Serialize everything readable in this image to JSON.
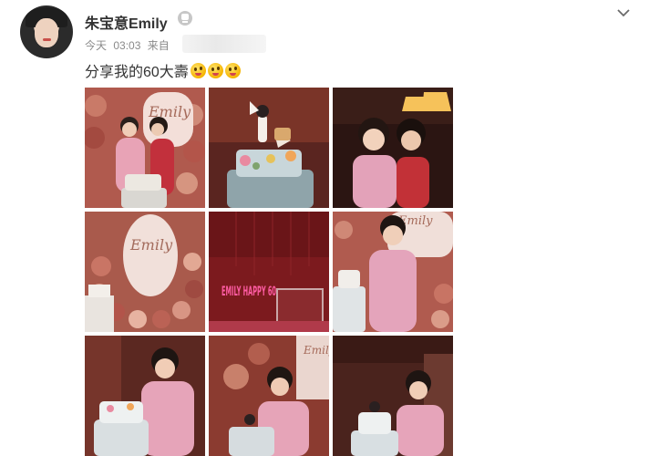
{
  "post": {
    "username": "朱宝意Emily",
    "meta": {
      "day": "今天",
      "time": "03:03",
      "from": "来自"
    },
    "text": "分享我的60大壽",
    "emoji_icon": "laughing-tongue-emoji"
  },
  "icons": {
    "badge": "robot-badge-icon",
    "menu": "chevron-down-icon"
  },
  "photos": [
    {
      "name": "photo-1",
      "desc_visible_text": "Emily"
    },
    {
      "name": "photo-2",
      "desc_visible_text": ""
    },
    {
      "name": "photo-3",
      "desc_visible_text": ""
    },
    {
      "name": "photo-4",
      "desc_visible_text": "Emily"
    },
    {
      "name": "photo-5",
      "desc_visible_text": "EMILY HAPPY 60"
    },
    {
      "name": "photo-6",
      "desc_visible_text": "Emily"
    },
    {
      "name": "photo-7",
      "desc_visible_text": ""
    },
    {
      "name": "photo-8",
      "desc_visible_text": "Emily"
    },
    {
      "name": "photo-9",
      "desc_visible_text": ""
    }
  ]
}
